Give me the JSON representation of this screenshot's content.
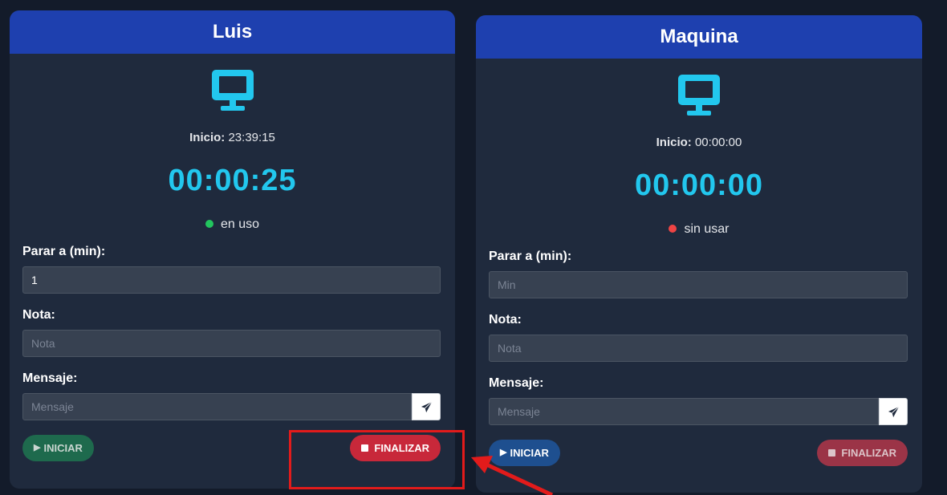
{
  "cards": [
    {
      "name": "Luis",
      "icon": "monitor-icon",
      "inicio_label": "Inicio:",
      "inicio_time": "23:39:15",
      "timer": "00:00:25",
      "status_text": "en uso",
      "status_color": "#22c55e",
      "parar_label": "Parar a (min):",
      "parar_value": "1",
      "parar_placeholder": "Min",
      "nota_label": "Nota:",
      "nota_value": "",
      "nota_placeholder": "Nota",
      "mensaje_label": "Mensaje:",
      "mensaje_value": "",
      "mensaje_placeholder": "Mensaje",
      "iniciar_label": "INICIAR",
      "iniciar_state": "disabled",
      "finalizar_label": "FINALIZAR",
      "finalizar_state": "active"
    },
    {
      "name": "Maquina",
      "icon": "monitor-icon",
      "inicio_label": "Inicio:",
      "inicio_time": "00:00:00",
      "timer": "00:00:00",
      "status_text": "sin usar",
      "status_color": "#ef4444",
      "parar_label": "Parar a (min):",
      "parar_value": "",
      "parar_placeholder": "Min",
      "nota_label": "Nota:",
      "nota_value": "",
      "nota_placeholder": "Nota",
      "mensaje_label": "Mensaje:",
      "mensaje_value": "",
      "mensaje_placeholder": "Mensaje",
      "iniciar_label": "INICIAR",
      "iniciar_state": "active",
      "finalizar_label": "FINALIZAR",
      "finalizar_state": "disabled"
    }
  ],
  "colors": {
    "background": "#131b2a",
    "card": "#1f2a3d",
    "header": "#1e40af",
    "timer": "#22c7ee",
    "monitor_icon": "#22c7ee",
    "annotation": "#e21b1b"
  }
}
